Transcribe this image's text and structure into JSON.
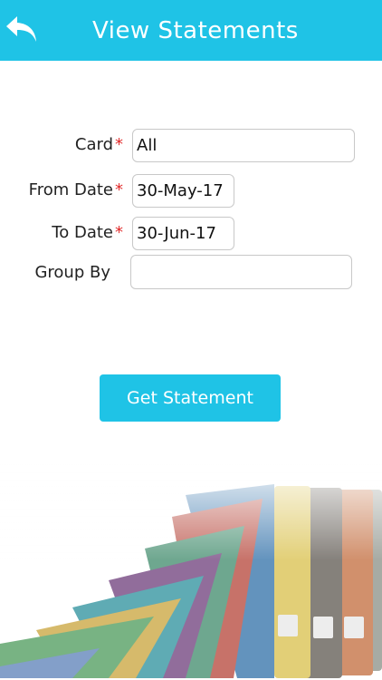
{
  "header": {
    "title": "View Statements",
    "back_icon": "back-arrow-icon",
    "background_color": "#1fc3e6"
  },
  "form": {
    "card": {
      "label": "Card",
      "required_mark": "*",
      "value": "All"
    },
    "from_date": {
      "label": "From Date",
      "required_mark": "*",
      "value": "30-May-17"
    },
    "to_date": {
      "label": "To Date",
      "required_mark": "*",
      "value": "30-Jun-17"
    },
    "group_by": {
      "label": "Group By",
      "value": ""
    }
  },
  "actions": {
    "get_statement_label": "Get Statement"
  },
  "colors": {
    "accent": "#1fc3e6",
    "required": "#e12a2a"
  }
}
